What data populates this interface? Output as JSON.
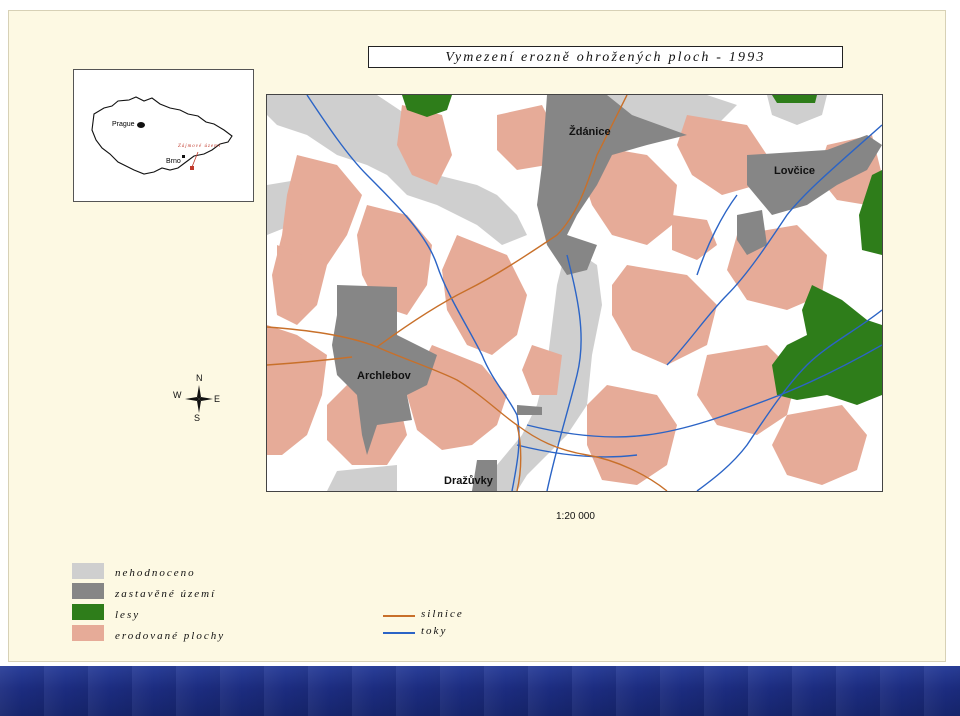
{
  "title": "Vymezení erozně ohrožených ploch - 1993",
  "inset_map": {
    "city_prague": "Prague",
    "city_brno": "Brno",
    "area_label": "Zájmové území"
  },
  "map_labels": {
    "zdanice": "Ždánice",
    "lovcice": "Lovčice",
    "archlebov": "Archlebov",
    "drazuvky": "Dražůvky"
  },
  "compass": {
    "n": "N",
    "s": "S",
    "e": "E",
    "w": "W"
  },
  "scale": "1:20 000",
  "legend": {
    "areas": [
      {
        "label": "nehodnoceno",
        "color": "#cfcfcf"
      },
      {
        "label": "zastavěné území",
        "color": "#868686"
      },
      {
        "label": "lesy",
        "color": "#2e7d1a"
      },
      {
        "label": "erodované plochy",
        "color": "#e6ab98"
      }
    ],
    "lines": [
      {
        "label": "silnice",
        "color": "#c8702a"
      },
      {
        "label": "toky",
        "color": "#2b64c6"
      }
    ]
  },
  "colors": {
    "background": "#fdf9e3",
    "eroded": "#e6ab98",
    "urban": "#868686",
    "unassessed": "#cfcfcf",
    "forest": "#2e7d1a",
    "road": "#c8702a",
    "stream": "#2b64c6"
  }
}
